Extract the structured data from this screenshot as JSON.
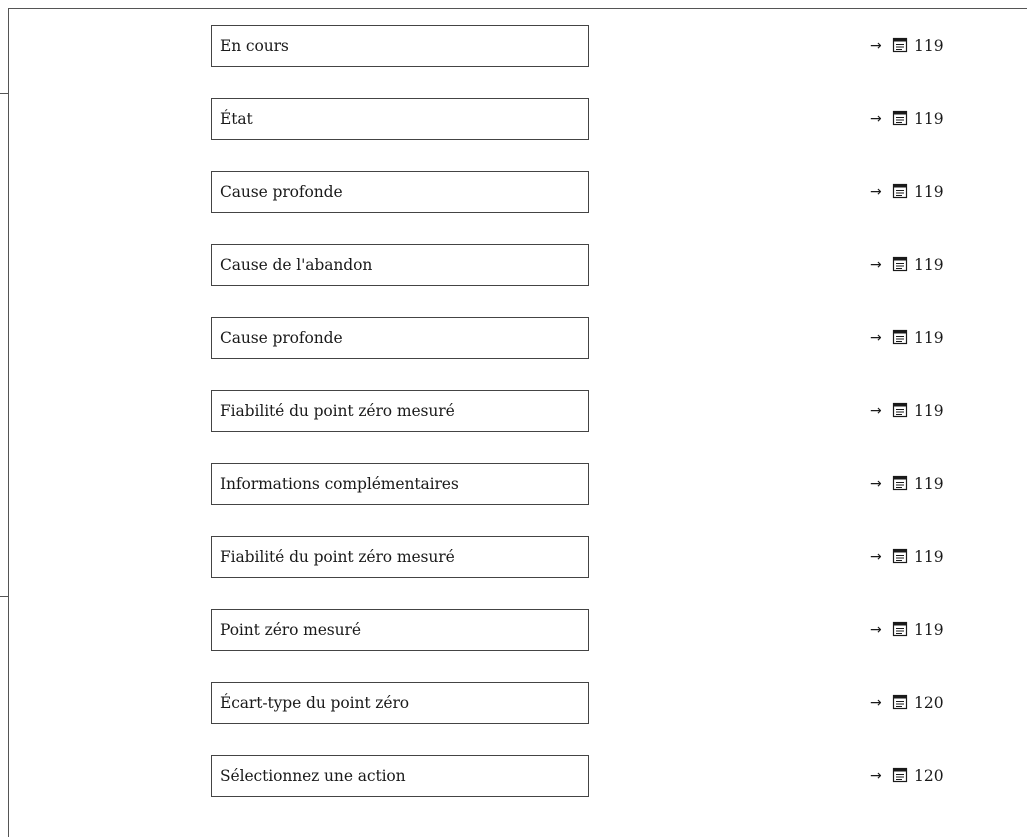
{
  "parameters": [
    {
      "label": "En cours",
      "arrow": "→",
      "page": "119"
    },
    {
      "label": "État",
      "arrow": "→",
      "page": "119"
    },
    {
      "label": "Cause profonde",
      "arrow": "→",
      "page": "119"
    },
    {
      "label": "Cause de l'abandon",
      "arrow": "→",
      "page": "119"
    },
    {
      "label": "Cause profonde",
      "arrow": "→",
      "page": "119"
    },
    {
      "label": "Fiabilité du point zéro mesuré",
      "arrow": "→",
      "page": "119"
    },
    {
      "label": "Informations complémentaires",
      "arrow": "→",
      "page": "119"
    },
    {
      "label": "Fiabilité du point zéro mesuré",
      "arrow": "→",
      "page": "119"
    },
    {
      "label": "Point zéro mesuré",
      "arrow": "→",
      "page": "119"
    },
    {
      "label": "Écart-type du point zéro",
      "arrow": "→",
      "page": "120"
    },
    {
      "label": "Sélectionnez une action",
      "arrow": "→",
      "page": "120"
    }
  ],
  "icons": {
    "page_reference": "book-icon"
  }
}
